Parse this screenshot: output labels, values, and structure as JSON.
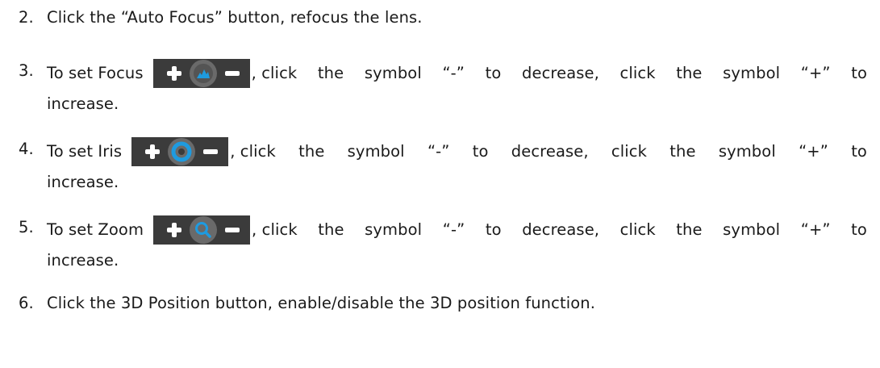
{
  "steps": [
    {
      "number": "2.",
      "text": "Click the “Auto Focus” button, refocus the lens."
    },
    {
      "number": "3.",
      "prefix": "To set Focus",
      "suffix_words": [
        ", click",
        "the",
        "symbol",
        "“-”",
        "to",
        "decrease,",
        "click",
        "the",
        "symbol",
        "“+”",
        "to"
      ],
      "continuation": "increase.",
      "icon": "focus-icon"
    },
    {
      "number": "4.",
      "prefix": "To set Iris",
      "suffix_words": [
        ", click",
        "the",
        "symbol",
        "“-”",
        "to",
        "decrease,",
        "click",
        "the",
        "symbol",
        "“+”",
        "to"
      ],
      "continuation": "increase.",
      "icon": "iris-icon"
    },
    {
      "number": "5.",
      "prefix": "To set Zoom",
      "suffix_words": [
        ", click",
        "the",
        "symbol",
        "“-”",
        "to",
        "decrease,",
        "click",
        "the",
        "symbol",
        "“+”",
        "to"
      ],
      "continuation": "increase.",
      "icon": "zoom-icon"
    },
    {
      "number": "6.",
      "text": "Click the 3D Position button, enable/disable the 3D position function."
    }
  ],
  "colors": {
    "text": "#1a1a1a",
    "control_bg": "#3b3b3b",
    "knob_bg": "#6a6a6a",
    "icon_accent": "#1e9be0"
  }
}
